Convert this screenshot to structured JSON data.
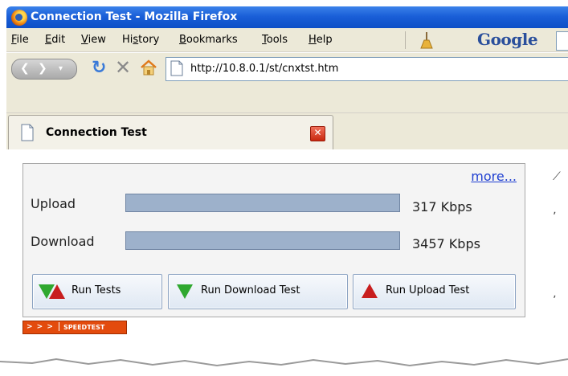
{
  "window": {
    "title": "Connection Test - Mozilla Firefox"
  },
  "menu": {
    "items": [
      {
        "label": "File",
        "accel": "F",
        "rest": "ile"
      },
      {
        "label": "Edit",
        "accel": "E",
        "rest": "dit"
      },
      {
        "label": "View",
        "accel": "V",
        "rest": "iew"
      },
      {
        "label": "History",
        "pre": "Hi",
        "accel": "s",
        "rest": "tory"
      },
      {
        "label": "Bookmarks",
        "accel": "B",
        "rest": "ookmarks"
      },
      {
        "label": "Tools",
        "accel": "T",
        "rest": "ools"
      },
      {
        "label": "Help",
        "accel": "H",
        "rest": "elp"
      }
    ],
    "search_engine": "Google"
  },
  "nav": {
    "url": "http://10.8.0.1/st/cnxtst.htm"
  },
  "tab": {
    "title": "Connection Test"
  },
  "speedtest": {
    "more_link": "more...",
    "upload": {
      "label": "Upload",
      "value": "317 Kbps",
      "fill_fraction": 1.0
    },
    "download": {
      "label": "Download",
      "value": "3457 Kbps",
      "fill_fraction": 1.0
    },
    "buttons": {
      "run_tests": "Run Tests",
      "run_download": "Run Download Test",
      "run_upload": "Run Upload Test"
    },
    "badge": {
      "chevrons": "> > >",
      "text": "SPEEDTEST"
    }
  },
  "colors": {
    "titlebar": "#1a5fd8",
    "bar": "#a3b7cf",
    "link": "#1f3fd1",
    "down_triangle": "#2fa82f",
    "up_triangle": "#c81e1e",
    "badge": "#e34b0d"
  }
}
